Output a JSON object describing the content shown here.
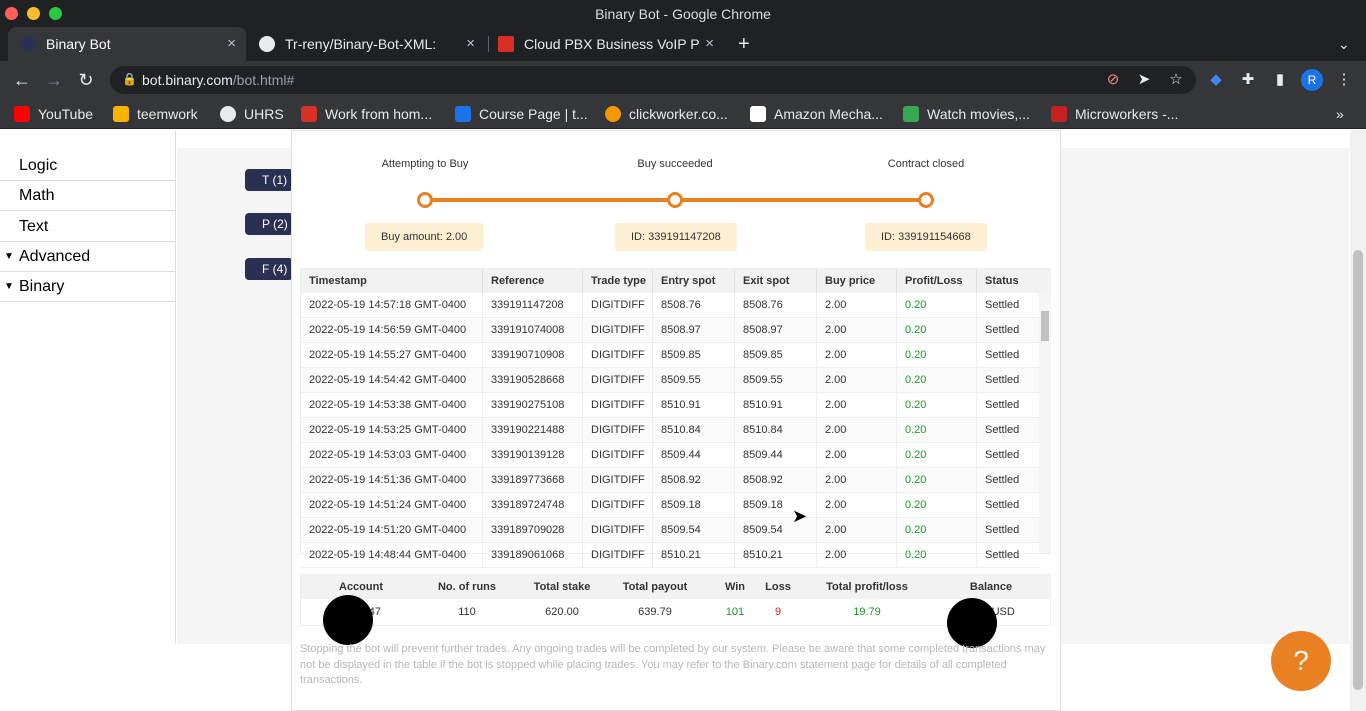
{
  "window": {
    "title": "Binary Bot - Google Chrome"
  },
  "tabs": [
    {
      "label": "Binary Bot",
      "close": "×"
    },
    {
      "label": "Tr-reny/Binary-Bot-XML:",
      "close": "×"
    },
    {
      "label": "Cloud PBX Business VoIP P",
      "close": "×"
    }
  ],
  "new_tab": "+",
  "tab_menu": "⌄",
  "address": {
    "domain": "bot.binary.com",
    "path": "/bot.html#"
  },
  "profile_initial": "R",
  "bookmarks": [
    {
      "label": "YouTube",
      "color": "#ff0000"
    },
    {
      "label": "teemwork",
      "color": "#f4b400"
    },
    {
      "label": "UHRS",
      "color": "#222222"
    },
    {
      "label": "Work from hom...",
      "color": "#d93025"
    },
    {
      "label": "Course Page | t...",
      "color": "#1a73e8"
    },
    {
      "label": "clickworker.co...",
      "color": "#f29900"
    },
    {
      "label": "Amazon Mecha...",
      "color": "#ffffff"
    },
    {
      "label": "Watch movies,...",
      "color": "#34a853"
    },
    {
      "label": "Microworkers -...",
      "color": "#c5221f"
    }
  ],
  "sidebar": {
    "items": [
      {
        "label": "Logic",
        "arrow": ""
      },
      {
        "label": "Math",
        "arrow": ""
      },
      {
        "label": "Text",
        "arrow": ""
      },
      {
        "label": "Advanced",
        "arrow": "▼"
      },
      {
        "label": "Binary",
        "arrow": "▼"
      }
    ]
  },
  "blocks": [
    "T (1)",
    "P (2)",
    "F (4)"
  ],
  "steps": [
    {
      "label": "Attempting to Buy",
      "badge": "Buy amount: 2.00"
    },
    {
      "label": "Buy succeeded",
      "badge": "ID: 339191147208"
    },
    {
      "label": "Contract closed",
      "badge": "ID: 339191154668"
    }
  ],
  "table": {
    "headers": [
      "Timestamp",
      "Reference",
      "Trade type",
      "Entry spot",
      "Exit spot",
      "Buy price",
      "Profit/Loss",
      "Status"
    ],
    "rows": [
      [
        "2022-05-19 14:57:18 GMT-0400",
        "339191147208",
        "DIGITDIFF",
        "8508.76",
        "8508.76",
        "2.00",
        "0.20",
        "Settled"
      ],
      [
        "2022-05-19 14:56:59 GMT-0400",
        "339191074008",
        "DIGITDIFF",
        "8508.97",
        "8508.97",
        "2.00",
        "0.20",
        "Settled"
      ],
      [
        "2022-05-19 14:55:27 GMT-0400",
        "339190710908",
        "DIGITDIFF",
        "8509.85",
        "8509.85",
        "2.00",
        "0.20",
        "Settled"
      ],
      [
        "2022-05-19 14:54:42 GMT-0400",
        "339190528668",
        "DIGITDIFF",
        "8509.55",
        "8509.55",
        "2.00",
        "0.20",
        "Settled"
      ],
      [
        "2022-05-19 14:53:38 GMT-0400",
        "339190275108",
        "DIGITDIFF",
        "8510.91",
        "8510.91",
        "2.00",
        "0.20",
        "Settled"
      ],
      [
        "2022-05-19 14:53:25 GMT-0400",
        "339190221488",
        "DIGITDIFF",
        "8510.84",
        "8510.84",
        "2.00",
        "0.20",
        "Settled"
      ],
      [
        "2022-05-19 14:53:03 GMT-0400",
        "339190139128",
        "DIGITDIFF",
        "8509.44",
        "8509.44",
        "2.00",
        "0.20",
        "Settled"
      ],
      [
        "2022-05-19 14:51:36 GMT-0400",
        "339189773668",
        "DIGITDIFF",
        "8508.92",
        "8508.92",
        "2.00",
        "0.20",
        "Settled"
      ],
      [
        "2022-05-19 14:51:24 GMT-0400",
        "339189724748",
        "DIGITDIFF",
        "8509.18",
        "8509.18",
        "2.00",
        "0.20",
        "Settled"
      ],
      [
        "2022-05-19 14:51:20 GMT-0400",
        "339189709028",
        "DIGITDIFF",
        "8509.54",
        "8509.54",
        "2.00",
        "0.20",
        "Settled"
      ],
      [
        "2022-05-19 14:48:44 GMT-0400",
        "339189061068",
        "DIGITDIFF",
        "8510.21",
        "8510.21",
        "2.00",
        "0.20",
        "Settled"
      ]
    ]
  },
  "summary": {
    "headers": [
      "Account",
      "No. of runs",
      "Total stake",
      "Total payout",
      "Win",
      "Loss",
      "Total profit/loss",
      "Balance"
    ],
    "values": [
      "V...0047",
      "110",
      "620.00",
      "639.79",
      "101",
      "9",
      "19.79",
      "...17 USD"
    ]
  },
  "disclaimer": "Stopping the bot will prevent further trades. Any ongoing trades will be completed by our system. Please be aware that some completed transactions may not be displayed in the table if the bot is stopped while placing trades. You may refer to the Binary.com statement page for details of all completed transactions.",
  "help_icon": "?",
  "colors": {
    "accent": "#e98024",
    "profit": "#1e9a26",
    "loss": "#d62727"
  }
}
